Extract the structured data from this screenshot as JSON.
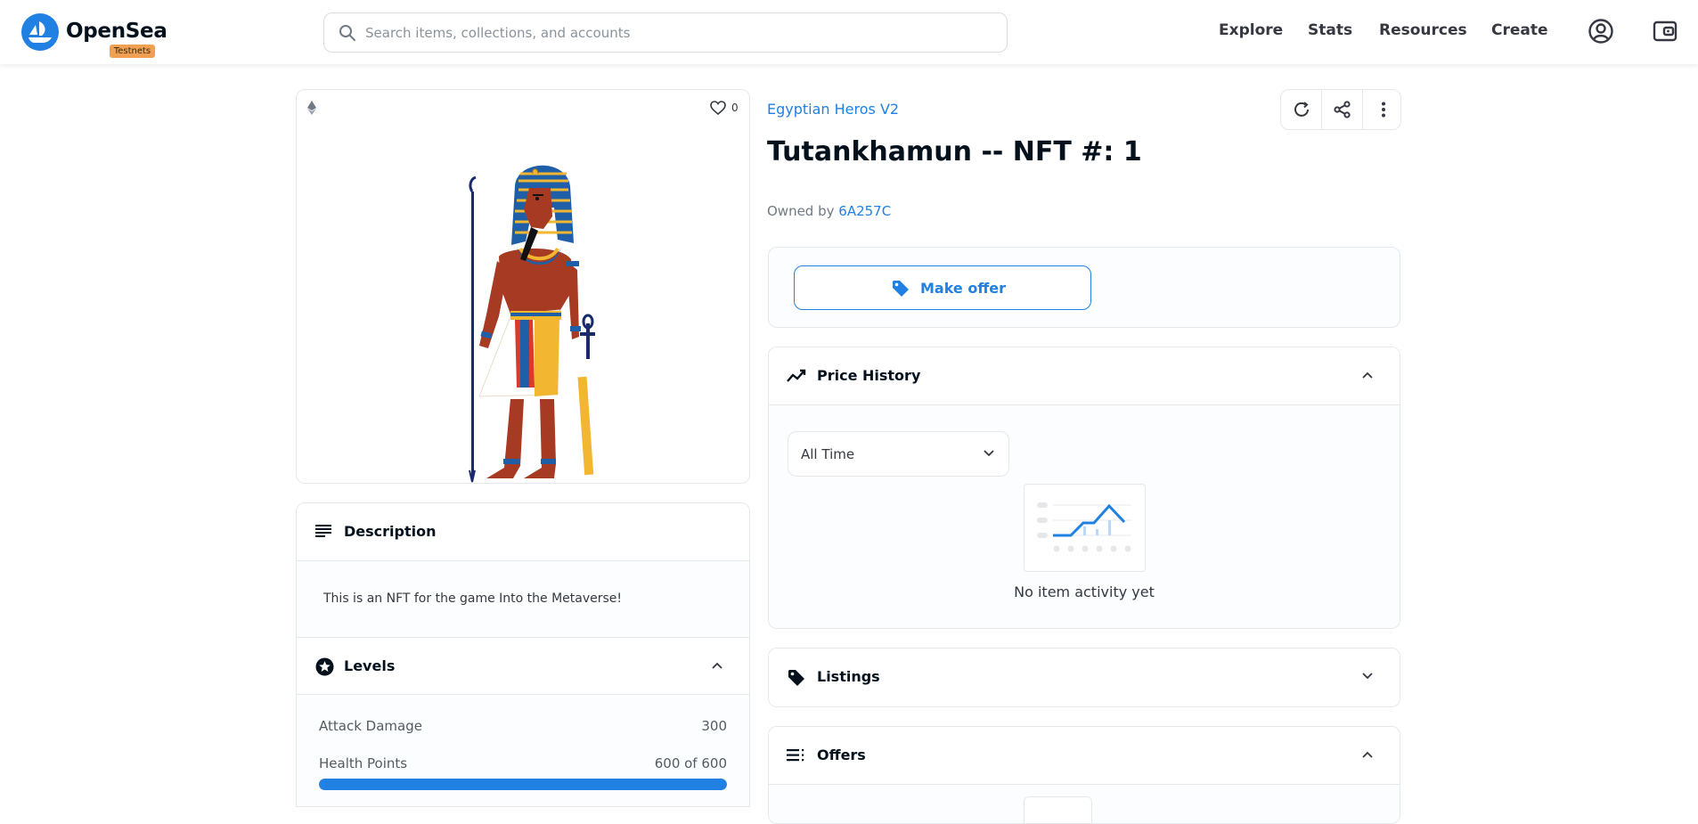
{
  "app": {
    "brand": "OpenSea",
    "badge": "Testnets",
    "accent": "#2081e2"
  },
  "search": {
    "placeholder": "Search items, collections, and accounts"
  },
  "nav": {
    "items": [
      "Explore",
      "Stats",
      "Resources",
      "Create"
    ],
    "icons": [
      "account-icon",
      "wallet-icon"
    ]
  },
  "item": {
    "favorites": "0",
    "collection": "Egyptian Heros V2",
    "title": "Tutankhamun -- NFT #: 1",
    "owned_by_label": "Owned by",
    "owner": "6A257C"
  },
  "actions": {
    "make_offer": "Make offer"
  },
  "price_history": {
    "title": "Price History",
    "filter": "All Time",
    "empty": "No item activity yet"
  },
  "listings": {
    "title": "Listings"
  },
  "offers": {
    "title": "Offers"
  },
  "description": {
    "title": "Description",
    "text": "This is an NFT for the game Into the Metaverse!"
  },
  "levels": {
    "title": "Levels",
    "items": [
      {
        "label": "Attack Damage",
        "value": "300"
      },
      {
        "label": "Health Points",
        "value": "600 of 600",
        "fill": 1.0
      }
    ]
  }
}
